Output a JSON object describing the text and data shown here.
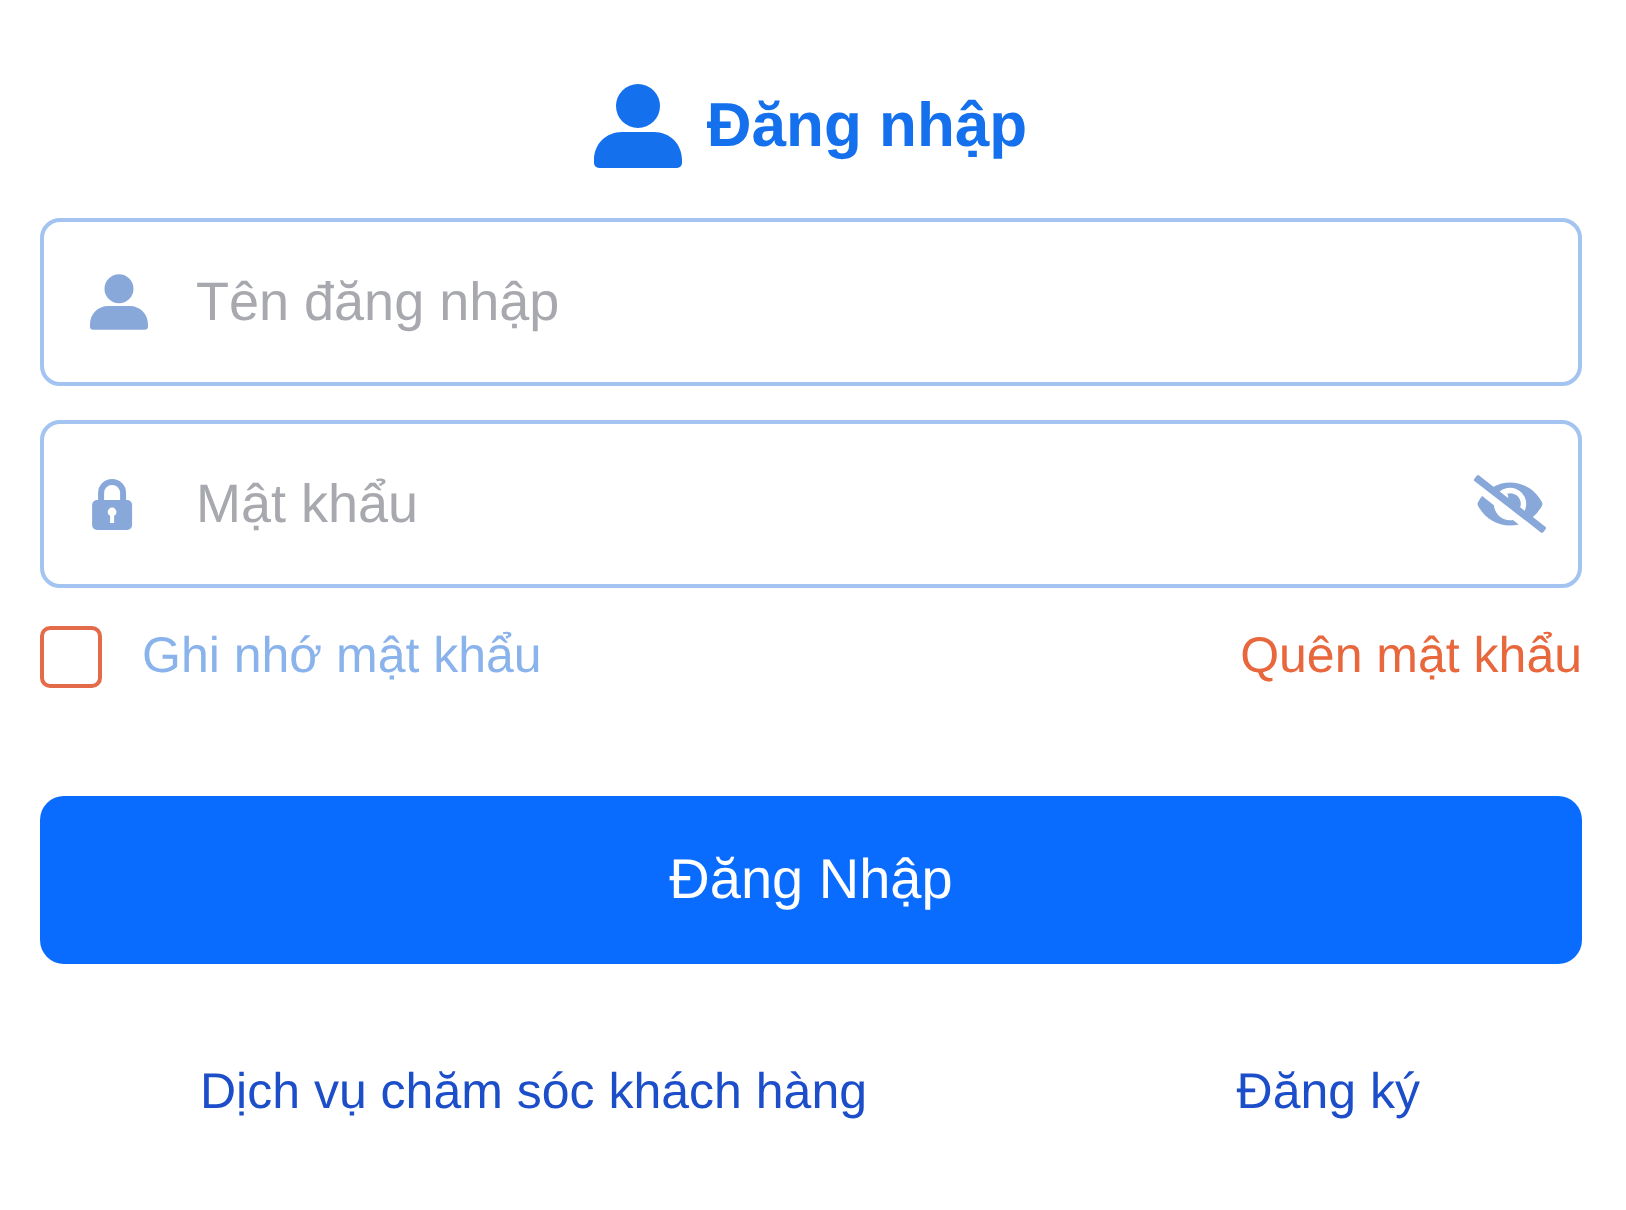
{
  "header": {
    "title": "Đăng nhập"
  },
  "fields": [
    {
      "kind": "username",
      "placeholder": "Tên đăng nhập"
    },
    {
      "kind": "password",
      "placeholder": "Mật khẩu",
      "password_visible": false
    }
  ],
  "remember": {
    "label": "Ghi nhớ mật khẩu",
    "checked": false
  },
  "forgot_link": "Quên mật khẩu",
  "login_button": "Đăng Nhập",
  "footer_links": [
    "Dịch vụ chăm sóc khách hàng",
    "Đăng ký"
  ]
}
